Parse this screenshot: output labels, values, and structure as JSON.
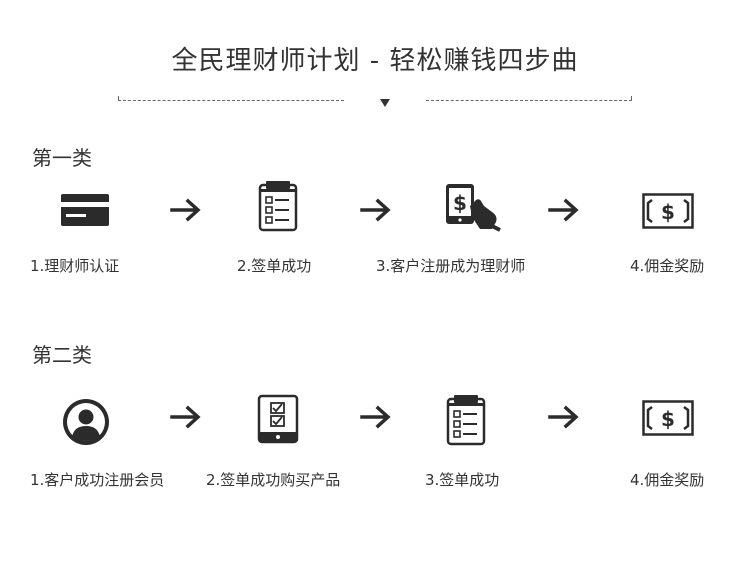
{
  "page": {
    "title": "全民理财师计划 - 轻松赚钱四步曲"
  },
  "sections": [
    {
      "title": "第一类",
      "steps": [
        {
          "label": "1.理财师认证",
          "icon": "credit-card-icon"
        },
        {
          "label": "2.签单成功",
          "icon": "clipboard-checklist-icon"
        },
        {
          "label": "3.客户注册成为理财师",
          "icon": "tablet-money-touch-icon"
        },
        {
          "label": "4.佣金奖励",
          "icon": "banknote-icon"
        }
      ]
    },
    {
      "title": "第二类",
      "steps": [
        {
          "label": "1.客户成功注册会员",
          "icon": "user-avatar-icon"
        },
        {
          "label": "2.签单成功购买产品",
          "icon": "tablet-checklist-icon"
        },
        {
          "label": "3.签单成功",
          "icon": "clipboard-checklist-icon"
        },
        {
          "label": "4.佣金奖励",
          "icon": "banknote-icon"
        }
      ]
    }
  ],
  "colors": {
    "icon": "#2b2b2b",
    "text": "#333333"
  }
}
